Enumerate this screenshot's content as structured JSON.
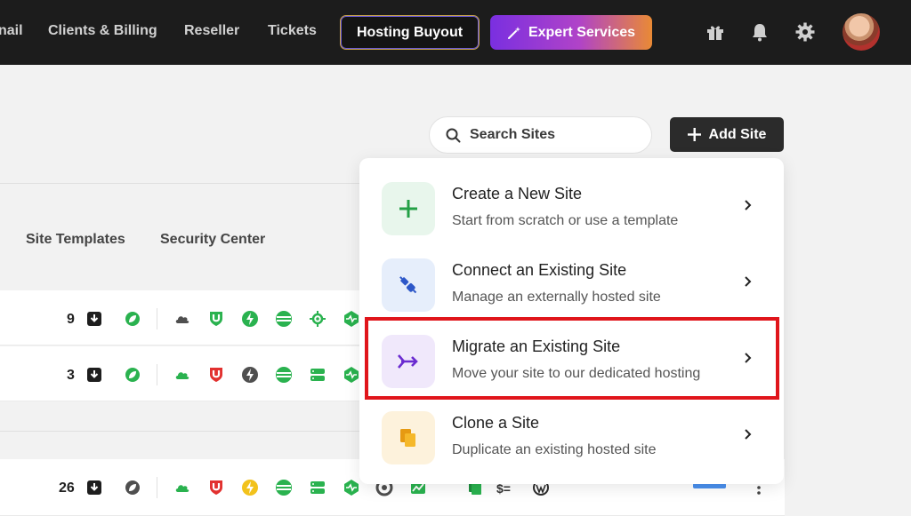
{
  "nav": {
    "items": [
      "nail",
      "Clients & Billing",
      "Reseller",
      "Tickets"
    ],
    "buyout_label": "Hosting Buyout",
    "expert_label": "Expert Services",
    "icons": [
      "gift-icon",
      "bell-icon",
      "gear-icon"
    ]
  },
  "toolbar": {
    "search_placeholder": "Search Sites",
    "add_label": "Add Site"
  },
  "columns": [
    "Site Templates",
    "Security Center"
  ],
  "rows": [
    {
      "count": "9"
    },
    {
      "count": "3"
    },
    {
      "count": "26"
    }
  ],
  "row_extras": {
    "price_label": "$="
  },
  "menu": {
    "items": [
      {
        "title": "Create a New Site",
        "subtitle": "Start from scratch or use a template",
        "icon": "plus-icon"
      },
      {
        "title": "Connect an Existing Site",
        "subtitle": "Manage an externally hosted site",
        "icon": "plug-icon"
      },
      {
        "title": "Migrate an Existing Site",
        "subtitle": "Move your site to our dedicated hosting",
        "icon": "migrate-icon"
      },
      {
        "title": "Clone a Site",
        "subtitle": "Duplicate an existing hosted site",
        "icon": "copy-icon"
      }
    ]
  },
  "colors": {
    "nav_bg": "#1c1c1c",
    "green": "#2ab24f",
    "red": "#e2312f",
    "highlight": "#e0151b",
    "dark_button": "#2b2b2b"
  }
}
